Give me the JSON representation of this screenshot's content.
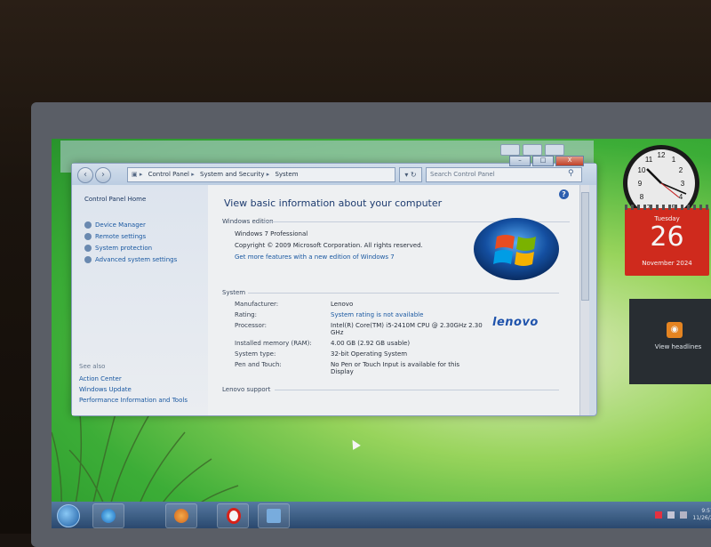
{
  "window": {
    "breadcrumb": [
      "Control Panel",
      "System and Security",
      "System"
    ],
    "search_placeholder": "Search Control Panel",
    "caption": {
      "minimize": "–",
      "maximize": "□",
      "close": "X"
    }
  },
  "sidebar": {
    "home": "Control Panel Home",
    "links": [
      "Device Manager",
      "Remote settings",
      "System protection",
      "Advanced system settings"
    ],
    "see_also_title": "See also",
    "see_also": [
      "Action Center",
      "Windows Update",
      "Performance Information and Tools"
    ]
  },
  "main": {
    "heading": "View basic information about your computer",
    "windows_edition": {
      "title": "Windows edition",
      "edition": "Windows 7 Professional",
      "copyright": "Copyright © 2009 Microsoft Corporation.  All rights reserved.",
      "more_features_link": "Get more features with a new edition of Windows 7"
    },
    "system": {
      "title": "System",
      "rows": [
        {
          "label": "Manufacturer:",
          "value": "Lenovo"
        },
        {
          "label": "Rating:",
          "value": "System rating is not available"
        },
        {
          "label": "Processor:",
          "value": "Intel(R) Core(TM) i5-2410M CPU @ 2.30GHz 2.30 GHz"
        },
        {
          "label": "Installed memory (RAM):",
          "value": "4.00 GB (2.92 GB usable)"
        },
        {
          "label": "System type:",
          "value": "32-bit Operating System"
        },
        {
          "label": "Pen and Touch:",
          "value": "No Pen or Touch Input is available for this Display"
        }
      ]
    },
    "lenovo_support": {
      "title": "Lenovo support"
    },
    "oem_logo": "lenovo"
  },
  "gadgets": {
    "calendar": {
      "weekday": "Tuesday",
      "day": "26",
      "month_year": "November 2024"
    },
    "feed": {
      "label": "View headlines"
    }
  },
  "colors": {
    "link": "#1b5ca8",
    "heading": "#1f3e74",
    "calendar_red": "#d82c1f",
    "lenovo_blue": "#2157b3"
  },
  "taskbar": {
    "items": [
      "start-orb",
      "internet-explorer",
      "media-player",
      "opera",
      "network"
    ],
    "time": "9:57 AM",
    "date": "11/26/2024"
  }
}
